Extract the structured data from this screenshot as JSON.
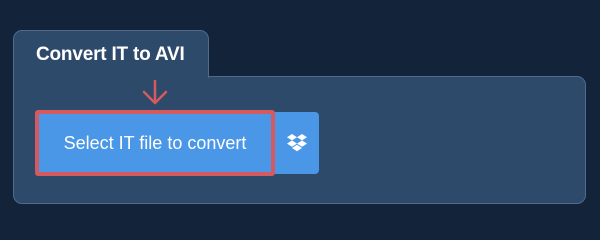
{
  "tab": {
    "title": "Convert IT to AVI"
  },
  "upload": {
    "select_label": "Select IT file to convert",
    "cloud_icon": "dropbox-icon"
  },
  "colors": {
    "background": "#13233a",
    "panel": "#2e4a6b",
    "button": "#4a97e8",
    "highlight": "#d45a5f",
    "text": "#ffffff"
  }
}
